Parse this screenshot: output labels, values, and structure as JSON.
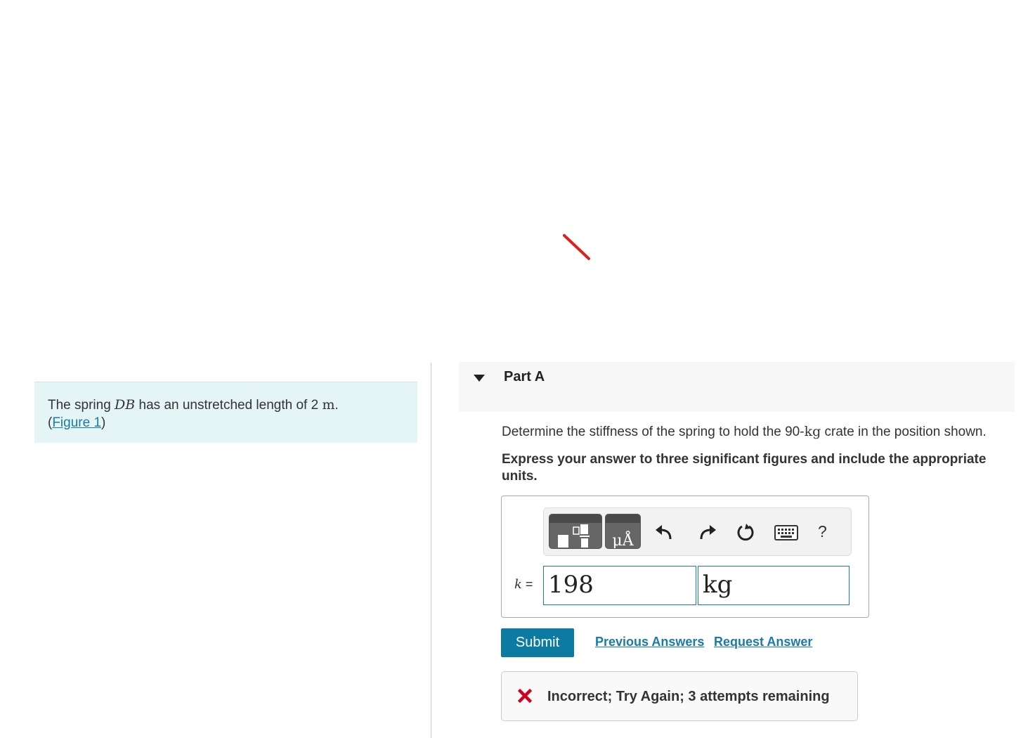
{
  "problem": {
    "text_before": "The spring ",
    "spring_name": "DB",
    "text_middle": " has an unstretched length of 2 ",
    "length_unit": "m",
    "text_after": ".",
    "figure_link_open": "(",
    "figure_link": "Figure 1",
    "figure_link_close": ")"
  },
  "part": {
    "title": "Part A",
    "question_before": "Determine the stiffness of the spring to hold the 90-",
    "question_unit": "kg",
    "question_after": " crate in the position shown.",
    "instruction": "Express your answer to three significant figures and include the appropriate units."
  },
  "toolbar": {
    "units_glyph": "μÅ",
    "help_label": "?"
  },
  "answer": {
    "variable": "k",
    "equals": " =",
    "value": "198",
    "units": "kg"
  },
  "actions": {
    "submit_label": "Submit",
    "previous_answers": "Previous Answers",
    "request_answer": "Request Answer"
  },
  "feedback": {
    "text": "Incorrect; Try Again; 3 attempts remaining"
  },
  "colors": {
    "accent": "#0b7ba2",
    "link": "#1a7aa8",
    "error": "#d0021b",
    "problem_bg": "#e5f5f5"
  }
}
